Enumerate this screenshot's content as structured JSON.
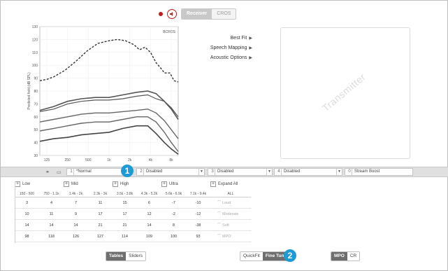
{
  "mode_toggle": {
    "options": [
      "Receiver",
      "CROS"
    ],
    "active": 0
  },
  "graph": {
    "y_label": "Predicted field (dB SPL)",
    "corner_label": "BCROS",
    "y_ticks": [
      "130",
      "120",
      "110",
      "100",
      "90",
      "80",
      "70",
      "60",
      "50",
      "40",
      "30"
    ],
    "x_ticks": [
      "125",
      "250",
      "500",
      "1k",
      "2k",
      "4k",
      "8k"
    ]
  },
  "menu": [
    {
      "label": "Best Fit"
    },
    {
      "label": "Speech Mapping"
    },
    {
      "label": "Acoustic Options"
    }
  ],
  "transmitter": {
    "label": "Transmitter"
  },
  "programs": [
    {
      "num": "1",
      "label": "*Normal"
    },
    {
      "num": "2",
      "label": "Disabled"
    },
    {
      "num": "3",
      "label": "Disabled"
    },
    {
      "num": "4",
      "label": "Disabled"
    },
    {
      "num": "0",
      "label": "Stream Boost"
    }
  ],
  "badges": [
    "1",
    "2"
  ],
  "table": {
    "groups": [
      "Low",
      "Mid",
      "High",
      "Ultra",
      "Expand All"
    ],
    "columns": [
      "150 - 500",
      "750 - 1.1k",
      "1.4k - 2k",
      "2.3k - 3k",
      "3.5k - 3.8k",
      "4.3k - 5.2k",
      "5.6k - 6.9k",
      "7.1k - 9.4k",
      "ALL"
    ],
    "rows": [
      {
        "values": [
          "3",
          "4",
          "7",
          "11",
          "15",
          "6",
          "-7",
          "-10"
        ],
        "label": "Loud"
      },
      {
        "values": [
          "10",
          "11",
          "9",
          "17",
          "17",
          "12",
          "-2",
          "-12"
        ],
        "label": "Moderate"
      },
      {
        "values": [
          "14",
          "14",
          "14",
          "21",
          "21",
          "14",
          "8",
          "-38"
        ],
        "label": "Soft"
      },
      {
        "values": [
          "98",
          "118",
          "126",
          "127",
          "114",
          "109",
          "100",
          "93"
        ],
        "label": "MPO"
      }
    ]
  },
  "view_toggle": {
    "options": [
      "Tables",
      "Sliders"
    ],
    "active": 0
  },
  "fit_toggle": {
    "options": [
      "QuickFit",
      "Fine Tuning"
    ],
    "active": 1
  },
  "curve_toggle": {
    "options": [
      "MPO",
      "CR"
    ],
    "active": 0
  }
}
